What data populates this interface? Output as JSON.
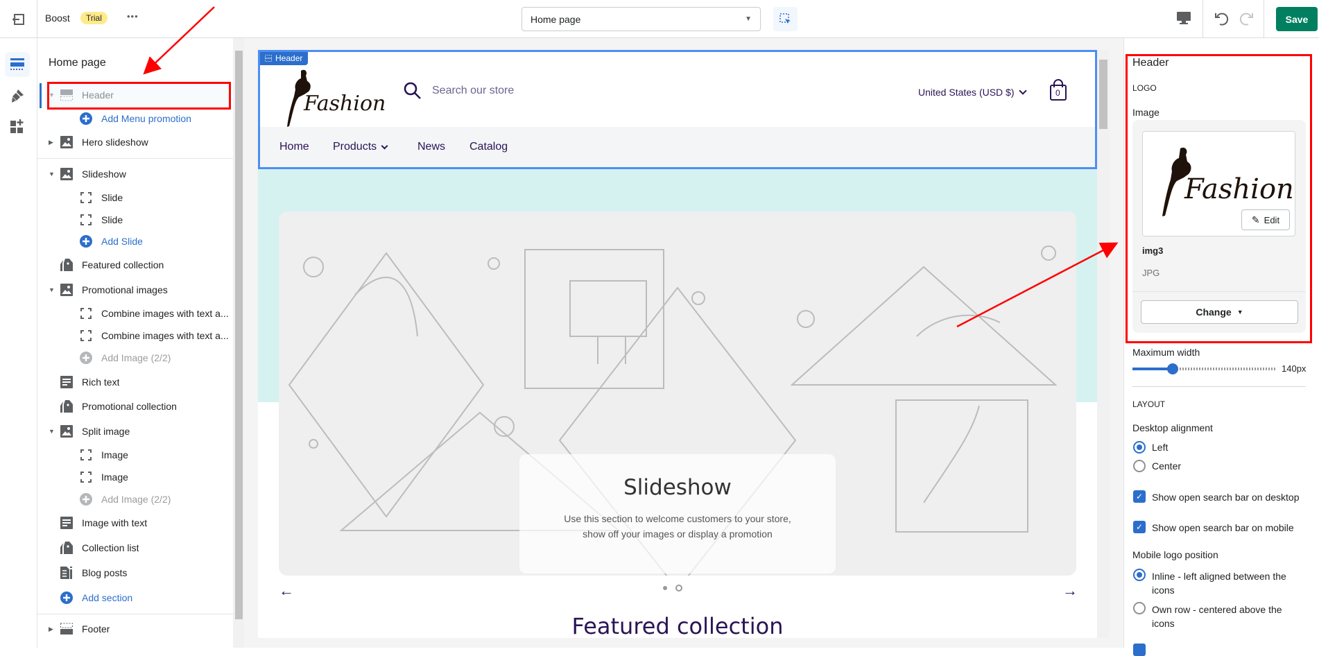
{
  "topbar": {
    "app_name": "Boost",
    "badge": "Trial",
    "more": "•••",
    "page_select": "Home page",
    "save_label": "Save"
  },
  "left_panel": {
    "title": "Home page",
    "items": [
      {
        "label": "Header",
        "icon": "header-icon",
        "expanded": true,
        "selected": true
      },
      {
        "label": "Add Menu promotion",
        "icon": "plus-circle-icon"
      },
      {
        "label": "Hero slideshow",
        "icon": "image-icon",
        "expanded": false
      },
      {
        "label": "Slideshow",
        "icon": "image-icon",
        "expanded": true
      },
      {
        "label": "Slide",
        "icon": "block-icon"
      },
      {
        "label": "Slide",
        "icon": "block-icon"
      },
      {
        "label": "Add Slide",
        "icon": "plus-circle-icon"
      },
      {
        "label": "Featured collection",
        "icon": "tag-icon"
      },
      {
        "label": "Promotional images",
        "icon": "image-icon",
        "expanded": true
      },
      {
        "label": "Combine images with text a...",
        "icon": "block-icon"
      },
      {
        "label": "Combine images with text a...",
        "icon": "block-icon"
      },
      {
        "label": "Add Image (2/2)",
        "icon": "plus-circle-icon",
        "disabled": true
      },
      {
        "label": "Rich text",
        "icon": "text-icon"
      },
      {
        "label": "Promotional collection",
        "icon": "tag-icon"
      },
      {
        "label": "Split image",
        "icon": "image-icon",
        "expanded": true
      },
      {
        "label": "Image",
        "icon": "block-icon"
      },
      {
        "label": "Image",
        "icon": "block-icon"
      },
      {
        "label": "Add Image (2/2)",
        "icon": "plus-circle-icon",
        "disabled": true
      },
      {
        "label": "Image with text",
        "icon": "text-icon"
      },
      {
        "label": "Collection list",
        "icon": "tag-icon"
      },
      {
        "label": "Blog posts",
        "icon": "blog-icon"
      },
      {
        "label": "Add section",
        "icon": "plus-circle-icon"
      },
      {
        "label": "Footer",
        "icon": "footer-icon",
        "expanded": false
      }
    ]
  },
  "preview": {
    "section_tag": "Header",
    "logo_text": "Fashion",
    "search_placeholder": "Search our store",
    "currency": "United States (USD $)",
    "cart_count": "0",
    "nav": [
      "Home",
      "Products",
      "News",
      "Catalog"
    ],
    "slideshow_title": "Slideshow",
    "slideshow_text_1": "Use this section to welcome customers to your store,",
    "slideshow_text_2": "show off your images or display a promotion",
    "featured_title": "Featured collection",
    "slide_count": 2,
    "active_slide": 1
  },
  "right_panel": {
    "title": "Header",
    "logo_heading": "LOGO",
    "image_label": "Image",
    "edit_label": "Edit",
    "file_name": "img3",
    "file_type": "JPG",
    "change_label": "Change",
    "max_width_label": "Maximum width",
    "max_width_value": "140px",
    "max_width_fraction": 0.28,
    "layout_heading": "LAYOUT",
    "desktop_alignment_label": "Desktop alignment",
    "desktop_alignment_options": [
      "Left",
      "Center"
    ],
    "desktop_alignment_selected": "Left",
    "checkbox_desktop": "Show open search bar on desktop",
    "checkbox_mobile": "Show open search bar on mobile",
    "mobile_logo_label": "Mobile logo position",
    "mobile_logo_option_1a": "Inline - left aligned between the",
    "mobile_logo_option_1b": "icons",
    "mobile_logo_option_2a": "Own row - centered above the",
    "mobile_logo_option_2b": "icons",
    "mobile_logo_selected": "Inline - left aligned between the icons"
  },
  "colors": {
    "accent": "#2c6ecb",
    "save": "#008060",
    "annotation": "#ff0000",
    "store_text": "#2a1454",
    "hero_bg": "#d5f2f1",
    "trial": "#ffea8a"
  }
}
